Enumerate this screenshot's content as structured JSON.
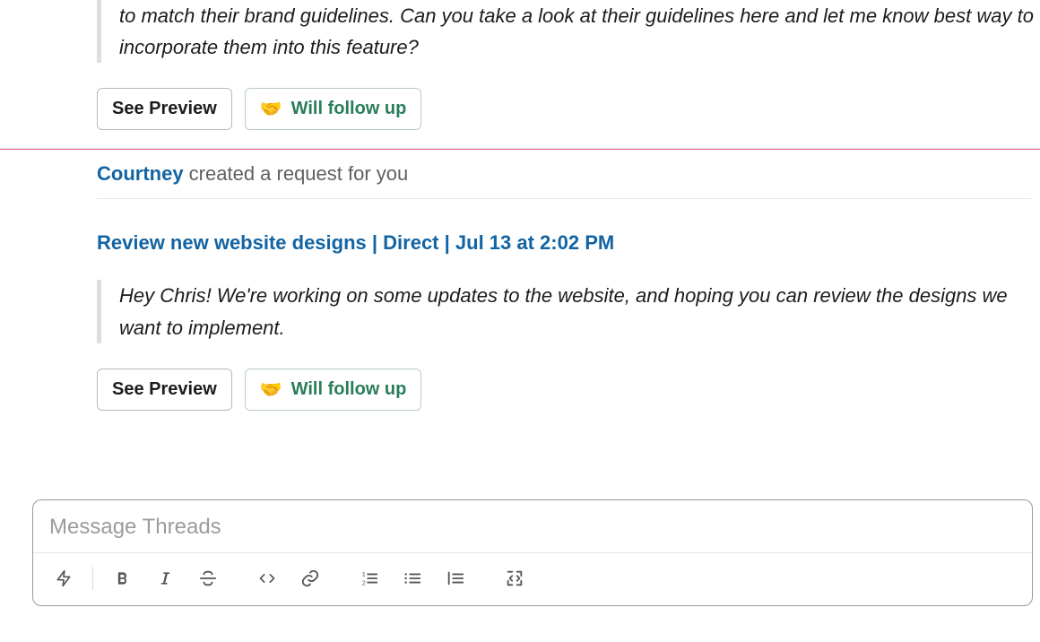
{
  "message1": {
    "quote": "to match their brand guidelines. Can you take a look at their guidelines here and let me know best way to incorporate them into this feature?",
    "see_preview": "See Preview",
    "follow_up": "Will follow up"
  },
  "message2": {
    "author": "Courtney",
    "created_text": " created a request for you",
    "title": "Review new website designs | Direct | Jul 13 at 2:02 PM",
    "quote": "Hey Chris! We're working on some updates to the website, and hoping you can review the designs we want to implement.",
    "see_preview": "See Preview",
    "follow_up": "Will follow up"
  },
  "composer": {
    "placeholder": "Message Threads"
  },
  "icons": {
    "handshake": "🤝"
  }
}
